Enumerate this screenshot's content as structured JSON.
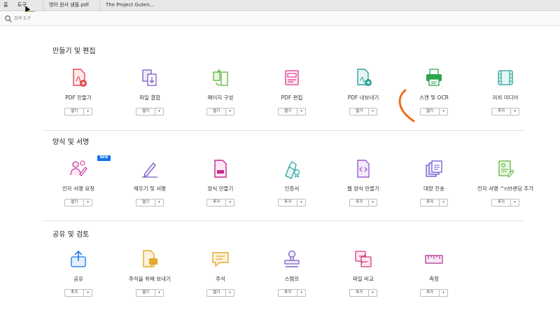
{
  "tabs": {
    "home": "홈",
    "tools": "도구",
    "tools_tooltip": "도구",
    "file1": "영어 원서 샘플.pdf",
    "file2": "The Project Guten..."
  },
  "search": {
    "placeholder": "검색 도구"
  },
  "sections": {
    "create_edit": {
      "title": "만들기 및 편집",
      "tools": [
        {
          "label": "PDF 만들기",
          "button": "열기",
          "icon": "create-pdf-icon"
        },
        {
          "label": "파일 결합",
          "button": "열기",
          "icon": "combine-files-icon"
        },
        {
          "label": "페이지 구성",
          "button": "열기",
          "icon": "organize-pages-icon"
        },
        {
          "label": "PDF 편집",
          "button": "열기",
          "icon": "edit-pdf-icon"
        },
        {
          "label": "PDF 내보내기",
          "button": "열기",
          "icon": "export-pdf-icon"
        },
        {
          "label": "스캔 및 OCR",
          "button": "열기",
          "icon": "scan-ocr-icon"
        },
        {
          "label": "리치 미디어",
          "button": "추가",
          "icon": "rich-media-icon"
        }
      ]
    },
    "forms_sign": {
      "title": "양식 및 서명",
      "new_badge": "NEW",
      "tools": [
        {
          "label": "전자 서명 요청",
          "button": "열기",
          "icon": "request-signature-icon"
        },
        {
          "label": "채우기 및 서명",
          "button": "열기",
          "icon": "fill-sign-icon"
        },
        {
          "label": "양식 만들기",
          "button": "추가",
          "icon": "prepare-form-icon"
        },
        {
          "label": "인증서",
          "button": "추가",
          "icon": "certificates-icon"
        },
        {
          "label": "웹 양식 만들기",
          "button": "추가",
          "icon": "web-form-icon"
        },
        {
          "label": "대량 전송",
          "button": "추가",
          "icon": "send-in-bulk-icon"
        },
        {
          "label": "전자 서명 ^n브랜딩 추가",
          "button": "추가",
          "icon": "signature-branding-icon"
        }
      ]
    },
    "share_review": {
      "title": "공유 및 검토",
      "tools": [
        {
          "label": "공유",
          "button": "추가",
          "icon": "share-icon"
        },
        {
          "label": "주석을 위해 보내기",
          "button": "열기",
          "icon": "send-for-comments-icon"
        },
        {
          "label": "주석",
          "button": "열기",
          "icon": "comment-icon"
        },
        {
          "label": "스탬프",
          "button": "추가",
          "icon": "stamp-icon"
        },
        {
          "label": "파일 비교",
          "button": "추가",
          "icon": "compare-files-icon"
        },
        {
          "label": "측정",
          "button": "추가",
          "icon": "measure-icon"
        }
      ]
    }
  },
  "caret": "▾",
  "colors": {
    "red": "#e34850",
    "purple": "#7b5cc4",
    "green": "#5db33c",
    "pink": "#d7378a",
    "teal": "#2ba29a",
    "blue": "#1473e6",
    "yellow": "#e5a92a",
    "annotation": "#f06a1d"
  }
}
